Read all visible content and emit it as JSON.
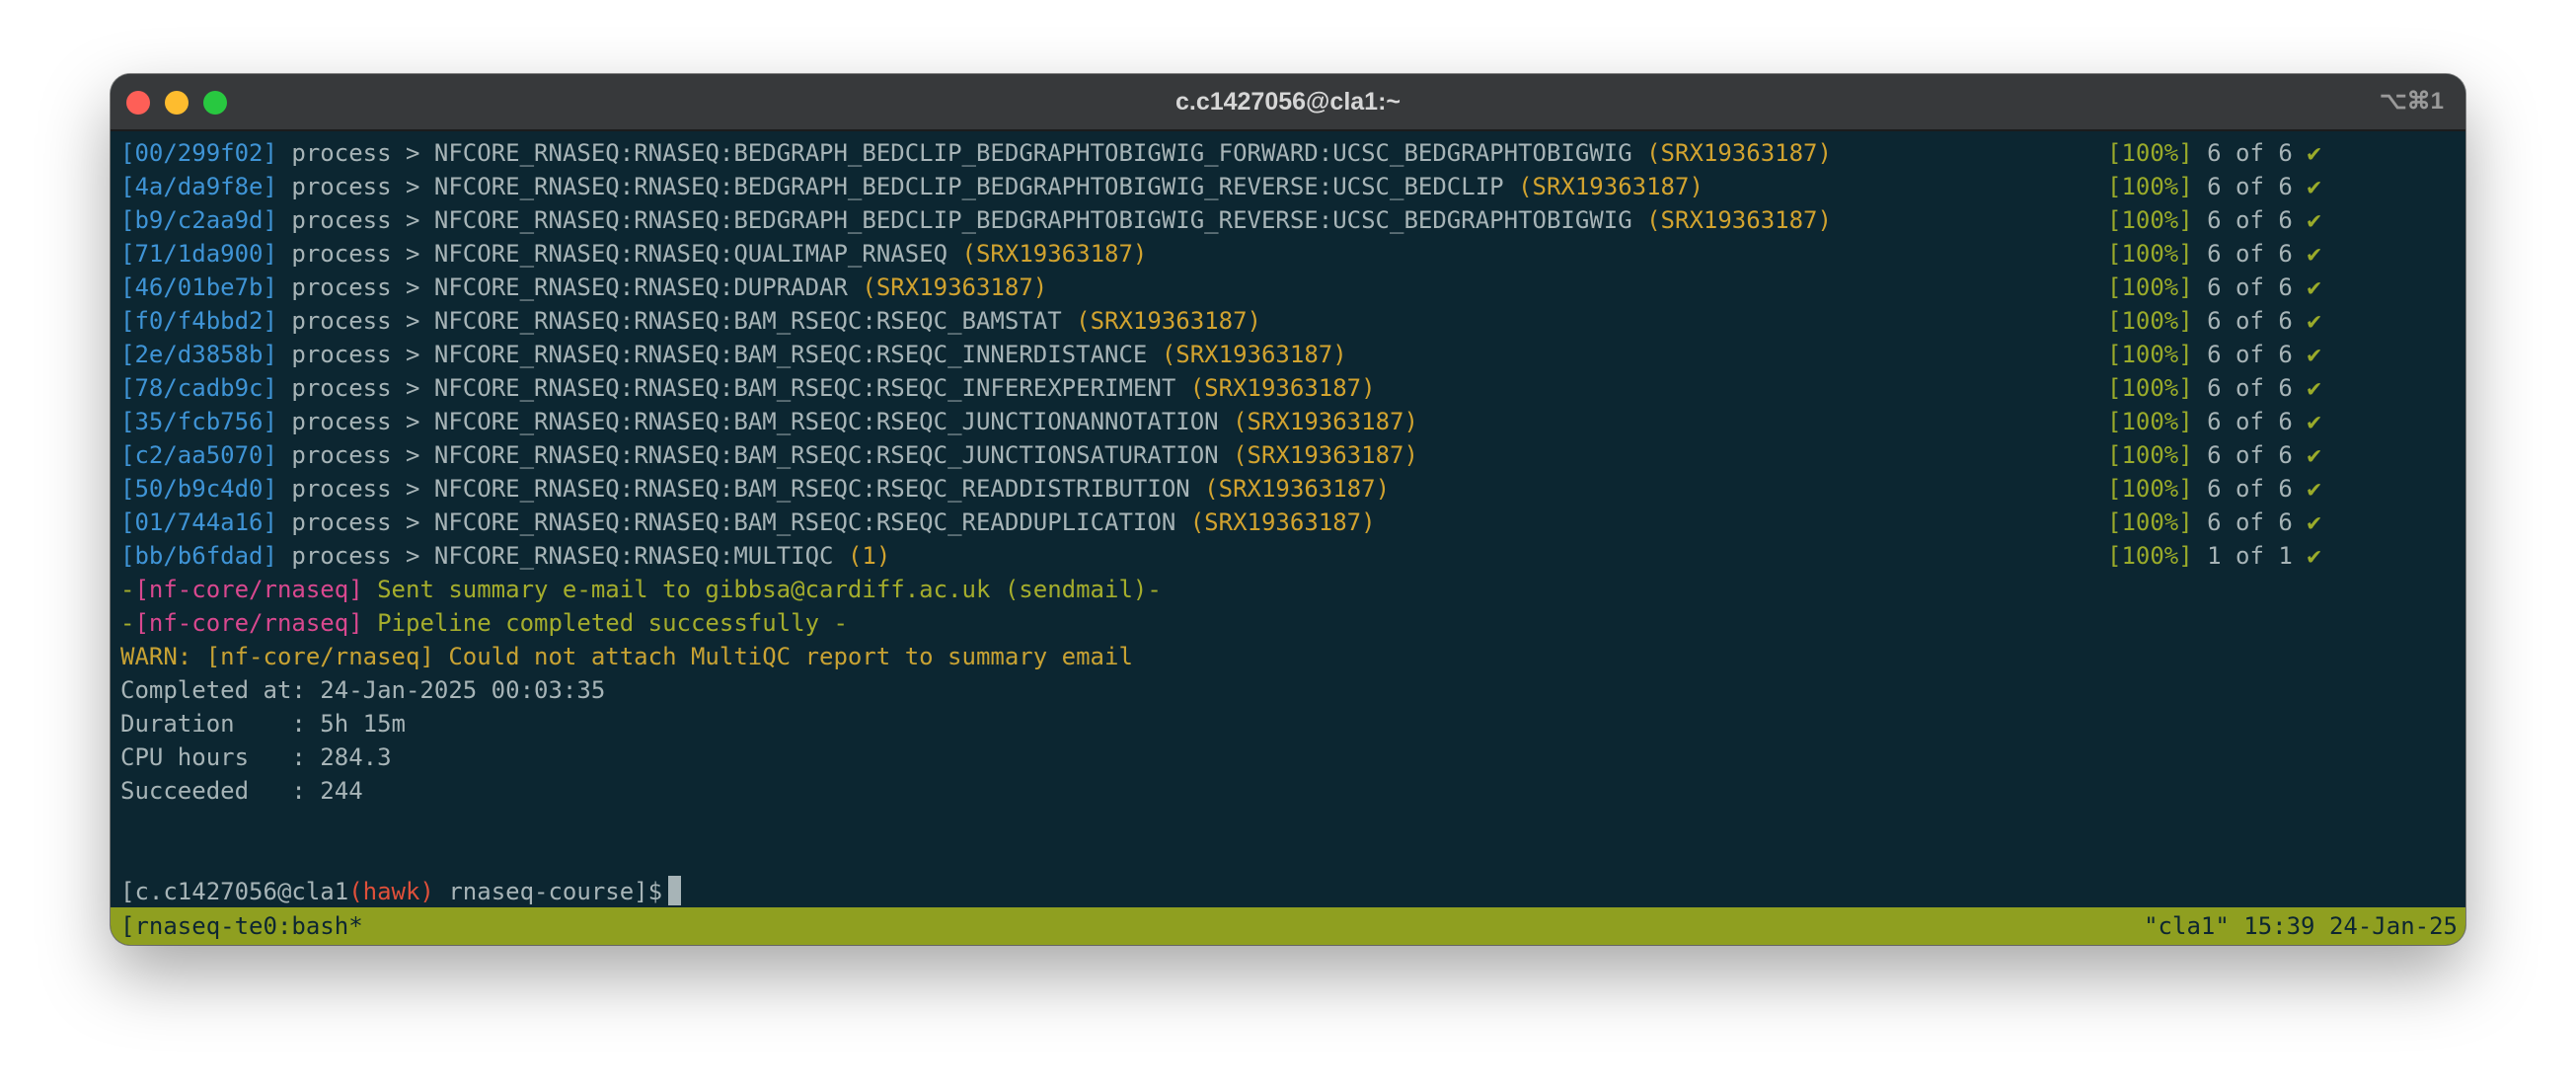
{
  "window": {
    "title": "c.c1427056@cla1:~",
    "shortcut": "⌥⌘1"
  },
  "processes": [
    {
      "hash": "[00/299f02]",
      "label": "process >",
      "name": "NFCORE_RNASEQ:RNASEQ:BEDGRAPH_BEDCLIP_BEDGRAPHTOBIGWIG_FORWARD:UCSC_BEDGRAPHTOBIGWIG",
      "tag": "(SRX19363187)",
      "pct": "[100%]",
      "count": "6 of 6",
      "check": "✔"
    },
    {
      "hash": "[4a/da9f8e]",
      "label": "process >",
      "name": "NFCORE_RNASEQ:RNASEQ:BEDGRAPH_BEDCLIP_BEDGRAPHTOBIGWIG_REVERSE:UCSC_BEDCLIP",
      "tag": "(SRX19363187)",
      "pct": "[100%]",
      "count": "6 of 6",
      "check": "✔"
    },
    {
      "hash": "[b9/c2aa9d]",
      "label": "process >",
      "name": "NFCORE_RNASEQ:RNASEQ:BEDGRAPH_BEDCLIP_BEDGRAPHTOBIGWIG_REVERSE:UCSC_BEDGRAPHTOBIGWIG",
      "tag": "(SRX19363187)",
      "pct": "[100%]",
      "count": "6 of 6",
      "check": "✔"
    },
    {
      "hash": "[71/1da900]",
      "label": "process >",
      "name": "NFCORE_RNASEQ:RNASEQ:QUALIMAP_RNASEQ",
      "tag": "(SRX19363187)",
      "pct": "[100%]",
      "count": "6 of 6",
      "check": "✔"
    },
    {
      "hash": "[46/01be7b]",
      "label": "process >",
      "name": "NFCORE_RNASEQ:RNASEQ:DUPRADAR",
      "tag": "(SRX19363187)",
      "pct": "[100%]",
      "count": "6 of 6",
      "check": "✔"
    },
    {
      "hash": "[f0/f4bbd2]",
      "label": "process >",
      "name": "NFCORE_RNASEQ:RNASEQ:BAM_RSEQC:RSEQC_BAMSTAT",
      "tag": "(SRX19363187)",
      "pct": "[100%]",
      "count": "6 of 6",
      "check": "✔"
    },
    {
      "hash": "[2e/d3858b]",
      "label": "process >",
      "name": "NFCORE_RNASEQ:RNASEQ:BAM_RSEQC:RSEQC_INNERDISTANCE",
      "tag": "(SRX19363187)",
      "pct": "[100%]",
      "count": "6 of 6",
      "check": "✔"
    },
    {
      "hash": "[78/cadb9c]",
      "label": "process >",
      "name": "NFCORE_RNASEQ:RNASEQ:BAM_RSEQC:RSEQC_INFEREXPERIMENT",
      "tag": "(SRX19363187)",
      "pct": "[100%]",
      "count": "6 of 6",
      "check": "✔"
    },
    {
      "hash": "[35/fcb756]",
      "label": "process >",
      "name": "NFCORE_RNASEQ:RNASEQ:BAM_RSEQC:RSEQC_JUNCTIONANNOTATION",
      "tag": "(SRX19363187)",
      "pct": "[100%]",
      "count": "6 of 6",
      "check": "✔"
    },
    {
      "hash": "[c2/aa5070]",
      "label": "process >",
      "name": "NFCORE_RNASEQ:RNASEQ:BAM_RSEQC:RSEQC_JUNCTIONSATURATION",
      "tag": "(SRX19363187)",
      "pct": "[100%]",
      "count": "6 of 6",
      "check": "✔"
    },
    {
      "hash": "[50/b9c4d0]",
      "label": "process >",
      "name": "NFCORE_RNASEQ:RNASEQ:BAM_RSEQC:RSEQC_READDISTRIBUTION",
      "tag": "(SRX19363187)",
      "pct": "[100%]",
      "count": "6 of 6",
      "check": "✔"
    },
    {
      "hash": "[01/744a16]",
      "label": "process >",
      "name": "NFCORE_RNASEQ:RNASEQ:BAM_RSEQC:RSEQC_READDUPLICATION",
      "tag": "(SRX19363187)",
      "pct": "[100%]",
      "count": "6 of 6",
      "check": "✔"
    },
    {
      "hash": "[bb/b6fdad]",
      "label": "process >",
      "name": "NFCORE_RNASEQ:RNASEQ:MULTIQC",
      "tag": "(1)",
      "pct": "[100%]",
      "count": "1 of 1",
      "check": "✔"
    }
  ],
  "messages": {
    "email": {
      "prefix": "-",
      "tag": "[nf-core/rnaseq]",
      "text": " Sent summary e-mail to gibbsa@cardiff.ac.uk (sendmail)-"
    },
    "complete": {
      "prefix": "-",
      "tag": "[nf-core/rnaseq]",
      "text": " Pipeline completed successfully -"
    },
    "warn": "WARN: [nf-core/rnaseq] Could not attach MultiQC report to summary email"
  },
  "summary": {
    "completed_at": "Completed at: 24-Jan-2025 00:03:35",
    "duration": "Duration    : 5h 15m",
    "cpu_hours": "CPU hours   : 284.3",
    "succeeded": "Succeeded   : 244"
  },
  "prompt": {
    "user_host": "[c.c1427056@cla1",
    "env": "(hawk)",
    "cwd": " rnaseq-course]$"
  },
  "statusbar": {
    "left": "[rnaseq-te0:bash*",
    "right": "\"cla1\" 15:39 24-Jan-25"
  }
}
